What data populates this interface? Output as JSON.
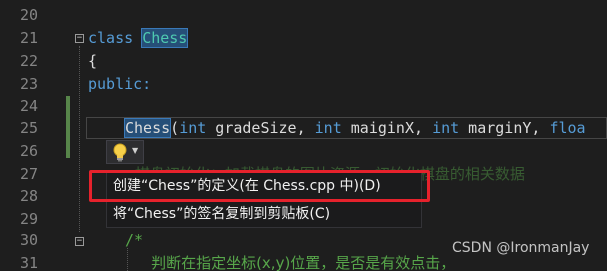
{
  "editor": {
    "line_numbers": [
      "20",
      "21",
      "22",
      "23",
      "24",
      "25",
      "26",
      "27",
      "28",
      "29",
      "30",
      "31"
    ],
    "lines": {
      "l21_kw": "class ",
      "l21_name": "Chess",
      "l22": "{",
      "l23": "public:",
      "l25_name": "Chess",
      "l25_p1": "(",
      "l25_kw1": "int",
      "l25_p2": " gradeSize, ",
      "l25_kw2": "int",
      "l25_p3": " maiginX, ",
      "l25_kw3": "int",
      "l25_p4": " marginY, ",
      "l25_kw4": "floa",
      "l27_ghost": "         棋盘初始化：加载棋盘的图片资源，初始化棋盘的相关数据",
      "l30": "/*",
      "l31": "    判断在指定坐标(x,y)位置，是否是有效点击，"
    }
  },
  "quick_actions": {
    "bulb_icon": "lightbulb-icon",
    "dropdown_icon": "chevron-down-icon",
    "items": [
      {
        "label": "创建“Chess”的定义(在 Chess.cpp 中)(D)"
      },
      {
        "label": "将“Chess”的签名复制到剪贴板(C)"
      }
    ]
  },
  "watermark": "CSDN @IronmanJay",
  "colors": {
    "background": "#1e1e1e",
    "keyword": "#569cd6",
    "type_name": "#4ec9b0",
    "highlight": "#264f78",
    "annotation_red": "#e6222c",
    "change_bar": "#57854a"
  }
}
